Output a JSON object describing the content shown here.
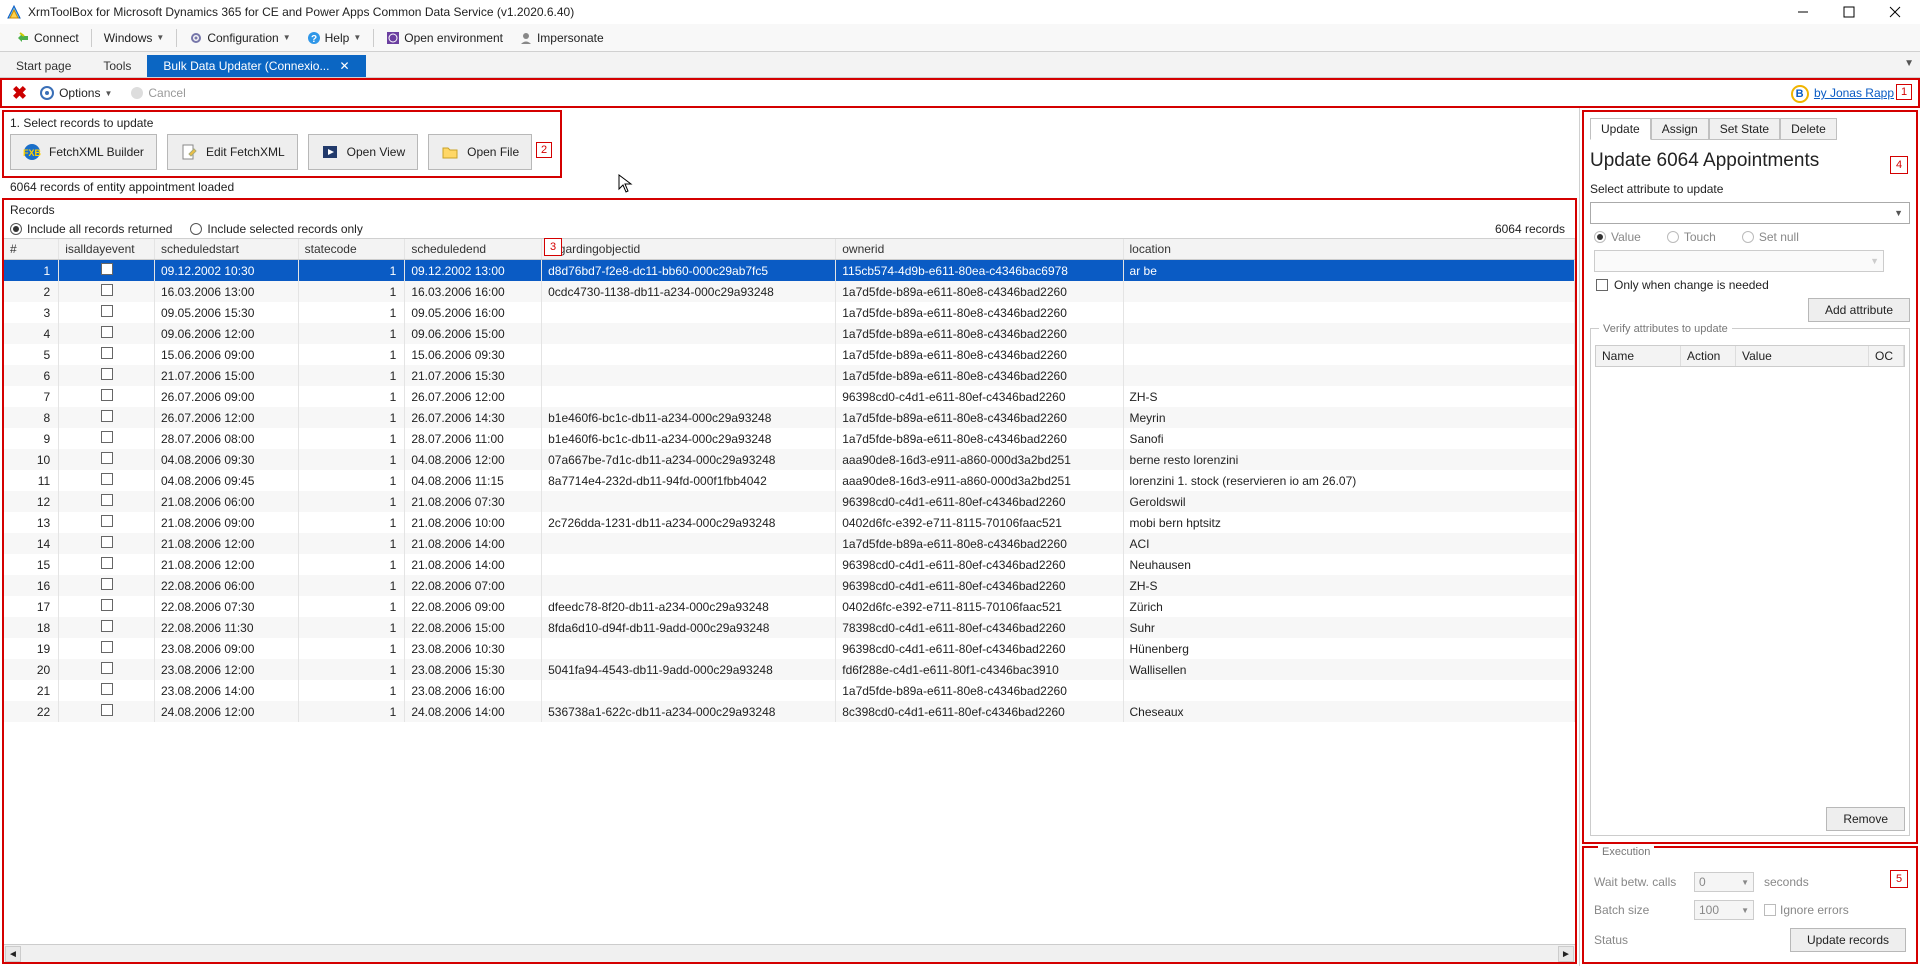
{
  "window": {
    "title": "XrmToolBox for Microsoft Dynamics 365 for CE and Power Apps Common Data Service (v1.2020.6.40)"
  },
  "toolbar": {
    "connect": "Connect",
    "windows": "Windows",
    "configuration": "Configuration",
    "help": "Help",
    "open_env": "Open environment",
    "impersonate": "Impersonate"
  },
  "tabs": {
    "start": "Start page",
    "tools": "Tools",
    "active": "Bulk Data Updater (Connexio..."
  },
  "options_bar": {
    "options": "Options",
    "cancel": "Cancel",
    "callout": "1",
    "by_prefix": "by ",
    "by_name": "Jonas Rapp"
  },
  "step1": {
    "label": "1. Select records to update",
    "fetchxml": "FetchXML Builder",
    "edit": "Edit FetchXML",
    "openview": "Open View",
    "openfile": "Open File",
    "callout": "2"
  },
  "status_line": "6064 records of entity appointment loaded",
  "records": {
    "header": "Records",
    "include_all": "Include all records returned",
    "include_sel": "Include selected records only",
    "count": "6064 records",
    "callout": "3",
    "columns": [
      "#",
      "isalldayevent",
      "scheduledstart",
      "statecode",
      "scheduledend",
      "regardingobjectid",
      "ownerid",
      "location"
    ],
    "rows": [
      {
        "i": "1",
        "ss": "09.12.2002 10:30",
        "sc": "1",
        "se": "09.12.2002 13:00",
        "ro": "d8d76bd7-f2e8-dc11-bb60-000c29ab7fc5",
        "ow": "115cb574-4d9b-e611-80ea-c4346bac6978",
        "loc": "ar be",
        "sel": true
      },
      {
        "i": "2",
        "ss": "16.03.2006 13:00",
        "sc": "1",
        "se": "16.03.2006 16:00",
        "ro": "0cdc4730-1138-db11-a234-000c29a93248",
        "ow": "1a7d5fde-b89a-e611-80e8-c4346bad2260",
        "loc": ""
      },
      {
        "i": "3",
        "ss": "09.05.2006 15:30",
        "sc": "1",
        "se": "09.05.2006 16:00",
        "ro": "",
        "ow": "1a7d5fde-b89a-e611-80e8-c4346bad2260",
        "loc": ""
      },
      {
        "i": "4",
        "ss": "09.06.2006 12:00",
        "sc": "1",
        "se": "09.06.2006 15:00",
        "ro": "",
        "ow": "1a7d5fde-b89a-e611-80e8-c4346bad2260",
        "loc": ""
      },
      {
        "i": "5",
        "ss": "15.06.2006 09:00",
        "sc": "1",
        "se": "15.06.2006 09:30",
        "ro": "",
        "ow": "1a7d5fde-b89a-e611-80e8-c4346bad2260",
        "loc": ""
      },
      {
        "i": "6",
        "ss": "21.07.2006 15:00",
        "sc": "1",
        "se": "21.07.2006 15:30",
        "ro": "",
        "ow": "1a7d5fde-b89a-e611-80e8-c4346bad2260",
        "loc": ""
      },
      {
        "i": "7",
        "ss": "26.07.2006 09:00",
        "sc": "1",
        "se": "26.07.2006 12:00",
        "ro": "",
        "ow": "96398cd0-c4d1-e611-80ef-c4346bad2260",
        "loc": "ZH-S"
      },
      {
        "i": "8",
        "ss": "26.07.2006 12:00",
        "sc": "1",
        "se": "26.07.2006 14:30",
        "ro": "b1e460f6-bc1c-db11-a234-000c29a93248",
        "ow": "1a7d5fde-b89a-e611-80e8-c4346bad2260",
        "loc": "Meyrin"
      },
      {
        "i": "9",
        "ss": "28.07.2006 08:00",
        "sc": "1",
        "se": "28.07.2006 11:00",
        "ro": "b1e460f6-bc1c-db11-a234-000c29a93248",
        "ow": "1a7d5fde-b89a-e611-80e8-c4346bad2260",
        "loc": "Sanofi"
      },
      {
        "i": "10",
        "ss": "04.08.2006 09:30",
        "sc": "1",
        "se": "04.08.2006 12:00",
        "ro": "07a667be-7d1c-db11-a234-000c29a93248",
        "ow": "aaa90de8-16d3-e911-a860-000d3a2bd251",
        "loc": "berne resto lorenzini"
      },
      {
        "i": "11",
        "ss": "04.08.2006 09:45",
        "sc": "1",
        "se": "04.08.2006 11:15",
        "ro": "8a7714e4-232d-db11-94fd-000f1fbb4042",
        "ow": "aaa90de8-16d3-e911-a860-000d3a2bd251",
        "loc": "lorenzini  1. stock (reservieren io am 26.07)"
      },
      {
        "i": "12",
        "ss": "21.08.2006 06:00",
        "sc": "1",
        "se": "21.08.2006 07:30",
        "ro": "",
        "ow": "96398cd0-c4d1-e611-80ef-c4346bad2260",
        "loc": "Geroldswil"
      },
      {
        "i": "13",
        "ss": "21.08.2006 09:00",
        "sc": "1",
        "se": "21.08.2006 10:00",
        "ro": "2c726dda-1231-db11-a234-000c29a93248",
        "ow": "0402d6fc-e392-e711-8115-70106faac521",
        "loc": "mobi bern hptsitz"
      },
      {
        "i": "14",
        "ss": "21.08.2006 12:00",
        "sc": "1",
        "se": "21.08.2006 14:00",
        "ro": "",
        "ow": "1a7d5fde-b89a-e611-80e8-c4346bad2260",
        "loc": "ACI"
      },
      {
        "i": "15",
        "ss": "21.08.2006 12:00",
        "sc": "1",
        "se": "21.08.2006 14:00",
        "ro": "",
        "ow": "96398cd0-c4d1-e611-80ef-c4346bad2260",
        "loc": "Neuhausen"
      },
      {
        "i": "16",
        "ss": "22.08.2006 06:00",
        "sc": "1",
        "se": "22.08.2006 07:00",
        "ro": "",
        "ow": "96398cd0-c4d1-e611-80ef-c4346bad2260",
        "loc": "ZH-S"
      },
      {
        "i": "17",
        "ss": "22.08.2006 07:30",
        "sc": "1",
        "se": "22.08.2006 09:00",
        "ro": "dfeedc78-8f20-db11-a234-000c29a93248",
        "ow": "0402d6fc-e392-e711-8115-70106faac521",
        "loc": "Zürich"
      },
      {
        "i": "18",
        "ss": "22.08.2006 11:30",
        "sc": "1",
        "se": "22.08.2006 15:00",
        "ro": "8fda6d10-d94f-db11-9add-000c29a93248",
        "ow": "78398cd0-c4d1-e611-80ef-c4346bad2260",
        "loc": "Suhr"
      },
      {
        "i": "19",
        "ss": "23.08.2006 09:00",
        "sc": "1",
        "se": "23.08.2006 10:30",
        "ro": "",
        "ow": "96398cd0-c4d1-e611-80ef-c4346bad2260",
        "loc": "Hünenberg"
      },
      {
        "i": "20",
        "ss": "23.08.2006 12:00",
        "sc": "1",
        "se": "23.08.2006 15:30",
        "ro": "5041fa94-4543-db11-9add-000c29a93248",
        "ow": "fd6f288e-c4d1-e611-80f1-c4346bac3910",
        "loc": "Wallisellen"
      },
      {
        "i": "21",
        "ss": "23.08.2006 14:00",
        "sc": "1",
        "se": "23.08.2006 16:00",
        "ro": "",
        "ow": "1a7d5fde-b89a-e611-80e8-c4346bad2260",
        "loc": ""
      },
      {
        "i": "22",
        "ss": "24.08.2006 12:00",
        "sc": "1",
        "se": "24.08.2006 14:00",
        "ro": "536738a1-622c-db11-a234-000c29a93248",
        "ow": "8c398cd0-c4d1-e611-80ef-c4346bad2260",
        "loc": "Cheseaux"
      }
    ]
  },
  "update_panel": {
    "tabs": {
      "update": "Update",
      "assign": "Assign",
      "setstate": "Set State",
      "delete": "Delete"
    },
    "title": "Update 6064 Appointments",
    "callout": "4",
    "select_attr": "Select attribute to update",
    "opt_value": "Value",
    "opt_touch": "Touch",
    "opt_setnull": "Set null",
    "only_change": "Only when change is needed",
    "add_attr": "Add attribute",
    "verify": "Verify attributes to update",
    "th_name": "Name",
    "th_action": "Action",
    "th_value": "Value",
    "th_oc": "OC",
    "remove": "Remove"
  },
  "exec_panel": {
    "title": "Execution",
    "callout": "5",
    "wait": "Wait betw. calls",
    "wait_val": "0",
    "seconds": "seconds",
    "batch": "Batch size",
    "batch_val": "100",
    "ignore": "Ignore errors",
    "status": "Status",
    "update_btn": "Update records"
  }
}
